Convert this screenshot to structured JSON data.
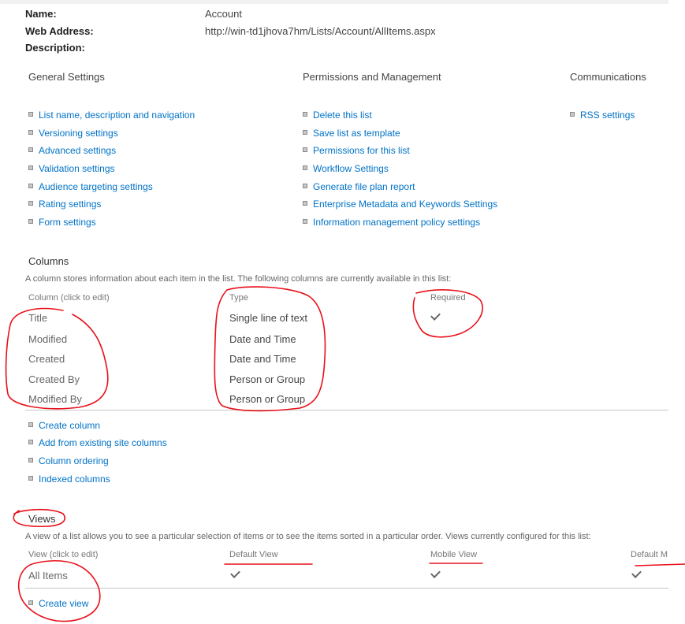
{
  "properties": {
    "name_label": "Name:",
    "name_value": "Account",
    "web_label": "Web Address:",
    "web_value": "http://win-td1jhova7hm/Lists/Account/AllItems.aspx",
    "desc_label": "Description:"
  },
  "settings": {
    "general": {
      "header": "General Settings",
      "links": [
        "List name, description and navigation",
        "Versioning settings",
        "Advanced settings",
        "Validation settings",
        "Audience targeting settings",
        "Rating settings",
        "Form settings"
      ]
    },
    "permissions": {
      "header": "Permissions and Management",
      "links": [
        "Delete this list",
        "Save list as template",
        "Permissions for this list",
        "Workflow Settings",
        "Generate file plan report",
        "Enterprise Metadata and Keywords Settings",
        "Information management policy settings"
      ]
    },
    "communications": {
      "header": "Communications",
      "links": [
        "RSS settings"
      ]
    }
  },
  "columns": {
    "title": "Columns",
    "description": "A column stores information about each item in the list. The following columns are currently available in this list:",
    "headers": {
      "column": "Column (click to edit)",
      "type": "Type",
      "required": "Required"
    },
    "rows": [
      {
        "name": "Title",
        "type": "Single line of text",
        "required": true
      },
      {
        "name": "Modified",
        "type": "Date and Time",
        "required": false
      },
      {
        "name": "Created",
        "type": "Date and Time",
        "required": false
      },
      {
        "name": "Created By",
        "type": "Person or Group",
        "required": false
      },
      {
        "name": "Modified By",
        "type": "Person or Group",
        "required": false
      }
    ],
    "links": [
      "Create column",
      "Add from existing site columns",
      "Column ordering",
      "Indexed columns"
    ]
  },
  "views": {
    "title": "Views",
    "description": "A view of a list allows you to see a particular selection of items or to see the items sorted in a particular order. Views currently configured for this list:",
    "headers": {
      "view": "View (click to edit)",
      "default": "Default View",
      "mobile": "Mobile View",
      "default_mobile": "Default M"
    },
    "rows": [
      {
        "name": "All Items",
        "default": true,
        "mobile": true,
        "default_mobile": true
      }
    ],
    "links": [
      "Create view"
    ]
  },
  "colors": {
    "link": "#0072c6",
    "annotation": "#e8101a",
    "text": "#444444"
  }
}
